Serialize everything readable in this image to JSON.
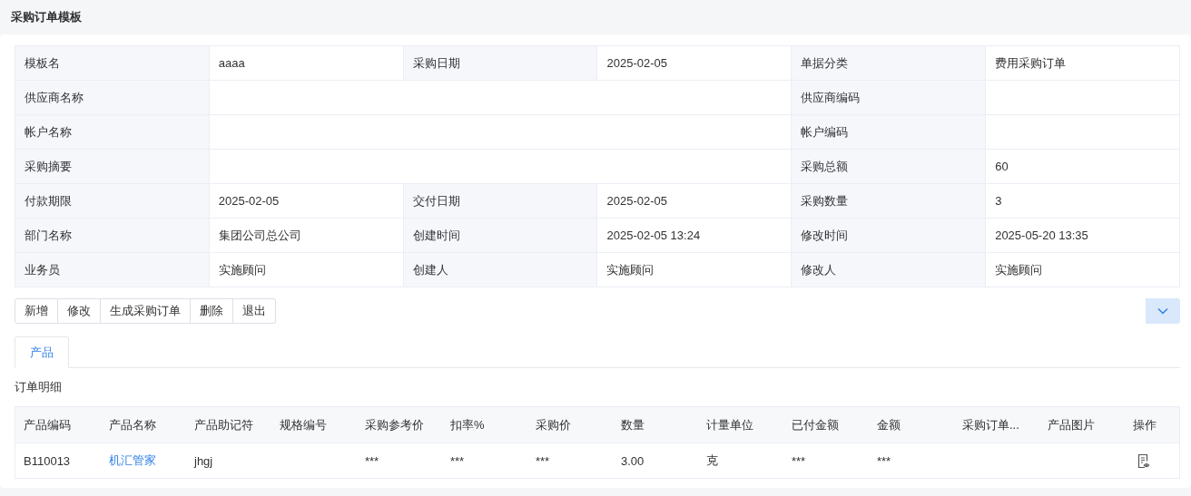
{
  "page": {
    "title": "采购订单模板"
  },
  "form": {
    "fields": [
      {
        "label": "模板名",
        "value": "aaaa",
        "kind": "normal"
      },
      {
        "label": "采购日期",
        "value": "2025-02-05",
        "kind": "normal"
      },
      {
        "label": "单据分类",
        "value": "费用采购订单",
        "kind": "normal"
      },
      {
        "label": "供应商名称",
        "kind": "wide"
      },
      {
        "label": "供应商编码",
        "kind": "normal"
      },
      {
        "label": "帐户名称",
        "kind": "wide"
      },
      {
        "label": "帐户编码",
        "kind": "normal"
      },
      {
        "label": "采购摘要",
        "kind": "wide"
      },
      {
        "label": "采购总额",
        "value": "60",
        "kind": "normal"
      },
      {
        "label": "付款期限",
        "value": "2025-02-05",
        "kind": "normal"
      },
      {
        "label": "交付日期",
        "value": "2025-02-05",
        "kind": "normal"
      },
      {
        "label": "采购数量",
        "value": "3",
        "kind": "normal"
      },
      {
        "label": "部门名称",
        "value": "集团公司总公司",
        "kind": "normal"
      },
      {
        "label": "创建时间",
        "value": "2025-02-05 13:24",
        "kind": "normal"
      },
      {
        "label": "修改时间",
        "value": "2025-05-20 13:35",
        "kind": "normal"
      },
      {
        "label": "业务员",
        "value": "实施顾问",
        "kind": "normal"
      },
      {
        "label": "创建人",
        "value": "实施顾问",
        "kind": "normal"
      },
      {
        "label": "修改人",
        "value": "实施顾问",
        "kind": "normal"
      }
    ]
  },
  "toolbar": {
    "buttons": [
      "新增",
      "修改",
      "生成采购订单",
      "删除",
      "退出"
    ]
  },
  "tabs": [
    {
      "label": "产品",
      "selected": true
    }
  ],
  "details": {
    "title": "订单明细",
    "columns": [
      "产品编码",
      "产品名称",
      "产品助记符",
      "规格编号",
      "采购参考价",
      "扣率%",
      "采购价",
      "数量",
      "计量单位",
      "已付金额",
      "金额",
      "采购订单...",
      "产品图片",
      "操作"
    ],
    "rows": [
      [
        {
          "kind": "text",
          "text": "B110013"
        },
        {
          "kind": "link",
          "text": "机汇管家"
        },
        {
          "kind": "text",
          "text": "jhgj"
        },
        {
          "kind": "empty"
        },
        {
          "kind": "text",
          "text": "***"
        },
        {
          "kind": "text",
          "text": "***"
        },
        {
          "kind": "text",
          "text": "***"
        },
        {
          "kind": "text",
          "text": "3.00"
        },
        {
          "kind": "text",
          "text": "克"
        },
        {
          "kind": "text",
          "text": "***"
        },
        {
          "kind": "text",
          "text": "***"
        },
        {
          "kind": "empty"
        },
        {
          "kind": "empty"
        },
        {
          "kind": "view-action"
        }
      ]
    ]
  }
}
